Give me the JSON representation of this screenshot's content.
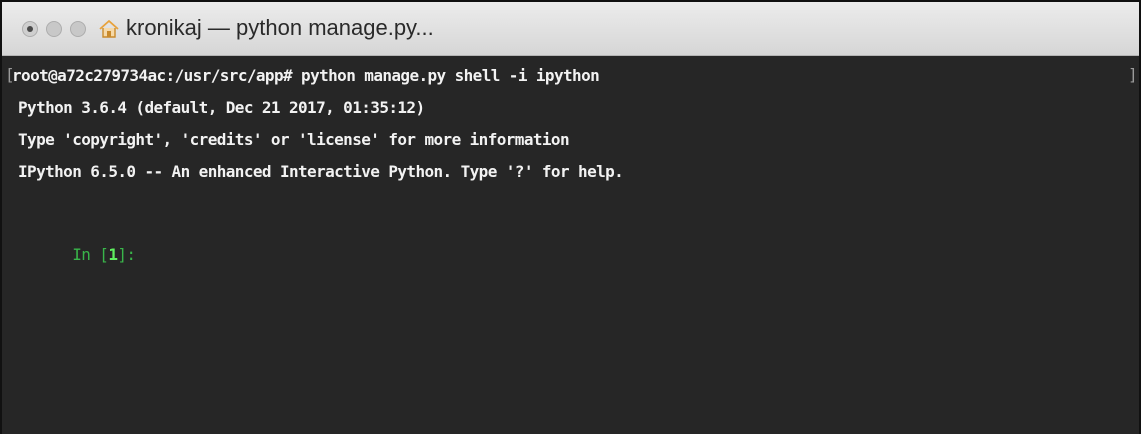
{
  "window": {
    "title": "kronikaj — python manage.py..."
  },
  "icons": {
    "close": "close-button",
    "minimize": "minimize-button",
    "maximize": "maximize-button",
    "home": "home-icon"
  },
  "colors": {
    "terminal_bg": "#262626",
    "terminal_text": "#f2f2f2",
    "prompt_green": "#39b54a",
    "prompt_number_green": "#5ff05f",
    "titlebar": "#e0e0e0"
  },
  "terminal": {
    "command_line": "root@a72c279734ac:/usr/src/app# python manage.py shell -i ipython",
    "lines": [
      "Python 3.6.4 (default, Dec 21 2017, 01:35:12)",
      "Type 'copyright', 'credits' or 'license' for more information",
      "IPython 6.5.0 -- An enhanced Interactive Python. Type '?' for help."
    ],
    "prompt": {
      "in_label": "In [",
      "number": "1",
      "close": "]:"
    }
  }
}
